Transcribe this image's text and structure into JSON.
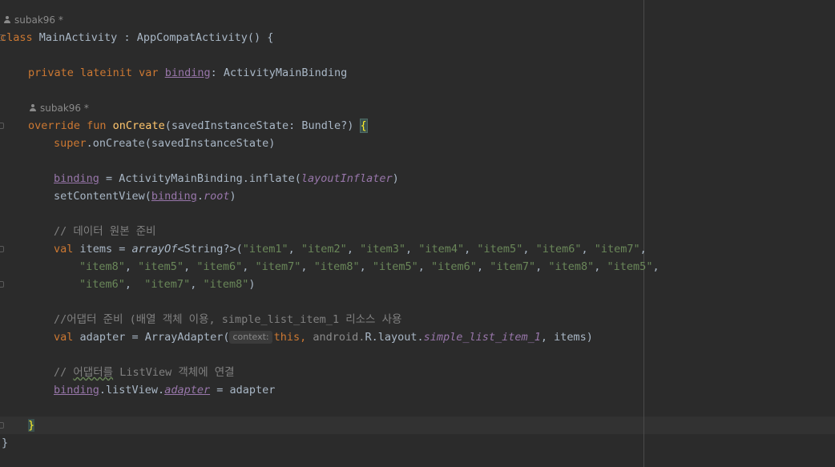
{
  "editor": {
    "authors": [
      {
        "name": "subak96",
        "mark": "*"
      },
      {
        "name": "subak96",
        "mark": "*"
      }
    ],
    "line_class": {
      "kw_class": "class",
      "name": "MainActivity",
      "colon": " : ",
      "super": "AppCompatActivity() {"
    },
    "line_binding_decl": {
      "kw": "private lateinit var ",
      "prop": "binding",
      "rest": ": ActivityMainBinding"
    },
    "line_oncreate": {
      "kw": "override fun ",
      "fn": "onCreate",
      "params": "(savedInstanceState: Bundle?) ",
      "brace": "{"
    },
    "line_super": {
      "kw": "super",
      "rest": ".onCreate(savedInstanceState)"
    },
    "line_inflate": {
      "prop": "binding",
      "mid": " = ActivityMainBinding.inflate(",
      "arg": "layoutInflater",
      "end": ")"
    },
    "line_setcontent": {
      "start": "setContentView(",
      "prop": "binding",
      "dot": ".",
      "root": "root",
      "end": ")"
    },
    "comment_data": "// 데이터 원본 준비",
    "line_items_1": {
      "kw": "val ",
      "name": "items = ",
      "fn": "arrayOf",
      "generic": "<String?>(",
      "s1": "\"item1\"",
      "s2": "\"item2\"",
      "s3": "\"item3\"",
      "s4": "\"item4\"",
      "s5": "\"item5\"",
      "s6": "\"item6\"",
      "s7": "\"item7\"",
      "sep": ", ",
      "tail": ","
    },
    "line_items_2": {
      "s1": "\"item8\"",
      "s2": "\"item5\"",
      "s3": "\"item6\"",
      "s4": "\"item7\"",
      "s5": "\"item8\"",
      "s6": "\"item5\"",
      "s7": "\"item6\"",
      "s8": "\"item7\"",
      "s9": "\"item8\"",
      "s10": "\"item5\"",
      "sep": ", ",
      "tail": ","
    },
    "line_items_3": {
      "s1": "\"item6\"",
      "sep1": ",  ",
      "s2": "\"item7\"",
      "sep2": ", ",
      "s3": "\"item8\"",
      "end": ")"
    },
    "comment_adapter": "//어댑터 준비 (배열 객체 이용, simple_list_item_1 리소스 사용",
    "line_adapter": {
      "kw": "val ",
      "start": "adapter = ArrayAdapter(",
      "hint": "context:",
      "this": "this",
      "sep": ", ",
      "pkg": "android.",
      "r": "R.layout.",
      "res": "simple_list_item_1",
      "end": ", items)"
    },
    "comment_connect_a": "// ",
    "comment_connect_wavy": "어댑터를",
    "comment_connect_b": " ListView 객체에 연결",
    "line_assign": {
      "prop": "binding",
      "mid": ".listView.",
      "adapter": "adapter",
      "end": " = adapter"
    },
    "close_fun": "}",
    "close_class": "}"
  }
}
